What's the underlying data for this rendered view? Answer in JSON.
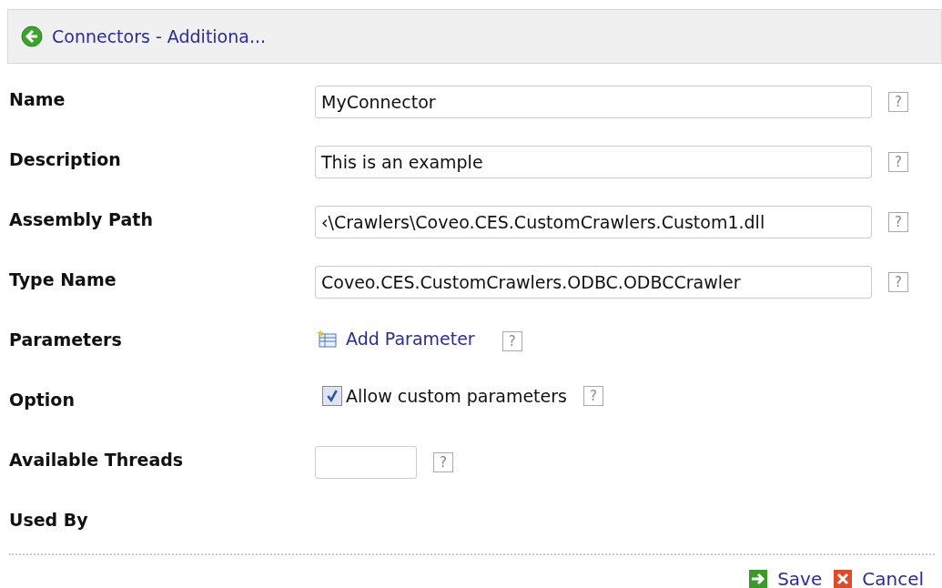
{
  "header": {
    "title": "Connectors - Additiona..."
  },
  "fields": [
    {
      "kind": "text",
      "label": "Name",
      "value": "MyConnector",
      "help": "?"
    },
    {
      "kind": "text",
      "label": "Description",
      "value": "This is an example",
      "help": "?"
    },
    {
      "kind": "text",
      "label": "Assembly Path",
      "value": "‹\\Crawlers\\Coveo.CES.CustomCrawlers.Custom1.dll",
      "help": "?"
    },
    {
      "kind": "text",
      "label": "Type Name",
      "value": "Coveo.CES.CustomCrawlers.ODBC.ODBCCrawler",
      "help": "?"
    },
    {
      "kind": "link",
      "label": "Parameters",
      "value": "Add Parameter",
      "help": "?"
    },
    {
      "kind": "checkbox",
      "label": "Option",
      "value": "Allow custom parameters",
      "checked": true,
      "help": "?"
    },
    {
      "kind": "short",
      "label": "Available Threads",
      "help": "?"
    },
    {
      "kind": "none",
      "label": "Used By"
    }
  ],
  "actions": [
    {
      "kind": "save",
      "label": "Save"
    },
    {
      "kind": "cancel",
      "label": "Cancel"
    }
  ]
}
